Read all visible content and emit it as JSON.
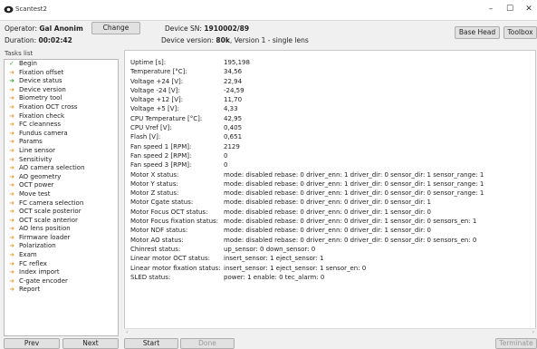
{
  "window": {
    "title": "Scantest2",
    "min_glyph": "–",
    "max_glyph": "☐",
    "close_glyph": "✕"
  },
  "header": {
    "operator_label": "Operator:",
    "operator_name": "Gal Anonim",
    "change_button": "Change",
    "duration_label": "Duration:",
    "duration_value": "00:02:42",
    "device_sn_label": "Device SN:",
    "device_sn_value": "1910002/89",
    "device_version_label": "Device version:",
    "device_version_value": "80k",
    "device_version_suffix": ", Version 1 - single lens",
    "base_head_button": "Base Head",
    "toolbox_button": "Toolbox"
  },
  "tasks": {
    "label": "Tasks list",
    "items": [
      {
        "label": "Begin",
        "icon": "check"
      },
      {
        "label": "Fixation offset",
        "icon": "arrow"
      },
      {
        "label": "Device status",
        "icon": "arrow-green"
      },
      {
        "label": "Device version",
        "icon": "arrow"
      },
      {
        "label": "Biometry tool",
        "icon": "arrow"
      },
      {
        "label": "Fixation OCT cross",
        "icon": "arrow"
      },
      {
        "label": "Fixation check",
        "icon": "arrow"
      },
      {
        "label": "FC cleanness",
        "icon": "arrow"
      },
      {
        "label": "Fundus camera",
        "icon": "arrow"
      },
      {
        "label": "Params",
        "icon": "arrow"
      },
      {
        "label": "Line sensor",
        "icon": "arrow"
      },
      {
        "label": "Sensitivity",
        "icon": "arrow"
      },
      {
        "label": "AO camera selection",
        "icon": "arrow"
      },
      {
        "label": "AO geometry",
        "icon": "arrow"
      },
      {
        "label": "OCT power",
        "icon": "arrow"
      },
      {
        "label": "Move test",
        "icon": "arrow"
      },
      {
        "label": "FC camera selection",
        "icon": "arrow"
      },
      {
        "label": "OCT scale posterior",
        "icon": "arrow"
      },
      {
        "label": "OCT scale anterior",
        "icon": "arrow"
      },
      {
        "label": "AO lens position",
        "icon": "arrow"
      },
      {
        "label": "Firmware loader",
        "icon": "arrow"
      },
      {
        "label": "Polarization",
        "icon": "arrow"
      },
      {
        "label": "Exam",
        "icon": "arrow"
      },
      {
        "label": "FC reflex",
        "icon": "arrow"
      },
      {
        "label": "Index import",
        "icon": "arrow"
      },
      {
        "label": "C-gate encoder",
        "icon": "arrow"
      },
      {
        "label": "Report",
        "icon": "arrow"
      }
    ]
  },
  "status": {
    "rows": [
      {
        "key": "Uptime [s]:",
        "value": "195,198"
      },
      {
        "key": "Temperature [°C]:",
        "value": "34,56"
      },
      {
        "key": "Voltage +24 [V]:",
        "value": "22,94"
      },
      {
        "key": "Voltage -24 [V]:",
        "value": "-24,59"
      },
      {
        "key": "Voltage +12 [V]:",
        "value": "11,70"
      },
      {
        "key": "Voltage +5 [V]:",
        "value": "4,33"
      },
      {
        "key": "CPU Temperature [°C]:",
        "value": "42,95"
      },
      {
        "key": "CPU Vref [V]:",
        "value": "0,405"
      },
      {
        "key": "Flash [V]:",
        "value": "0,651"
      },
      {
        "key": "Fan speed 1 [RPM]:",
        "value": "2129"
      },
      {
        "key": "Fan speed 2 [RPM]:",
        "value": "0"
      },
      {
        "key": "Fan speed 3 [RPM]:",
        "value": "0"
      },
      {
        "key": "Motor X status:",
        "value": "mode: disabled  rebase: 0  driver_enn: 1  driver_dir: 0  sensor_dir: 1  sensor_range: 1"
      },
      {
        "key": "Motor Y status:",
        "value": "mode: disabled  rebase: 0  driver_enn: 1  driver_dir: 0  sensor_dir: 1  sensor_range: 1"
      },
      {
        "key": "Motor Z status:",
        "value": "mode: disabled  rebase: 0  driver_enn: 1  driver_dir: 0  sensor_dir: 0  sensor_range: 1"
      },
      {
        "key": "Motor Cgate status:",
        "value": "mode: disabled  rebase: 0  driver_enn: 0  driver_dir: 0  sensor_dir: 1"
      },
      {
        "key": "Motor Focus OCT status:",
        "value": "mode: disabled  rebase: 0  driver_enn: 0  driver_dir: 1  sensor_dir: 0"
      },
      {
        "key": "Motor Focus fixation status:",
        "value": "mode: disabled  rebase: 0  driver_enn: 0  driver_dir: 1  sensor_dir: 0  sensors_en: 1"
      },
      {
        "key": "Motor NDF status:",
        "value": "mode: disabled  rebase: 0  driver_enn: 0  driver_dir: 1  sensor_dir: 0"
      },
      {
        "key": "Motor AO status:",
        "value": "mode: disabled  rebase: 0  driver_enn: 0  driver_dir: 0  sensor_dir: 0  sensors_en: 0"
      },
      {
        "key": "Chinrest status:",
        "value": "up_sensor: 0  down_sensor: 0"
      },
      {
        "key": "Linear motor OCT status:",
        "value": "insert_sensor: 1  eject_sensor: 1"
      },
      {
        "key": "Linear motor fixation status:",
        "value": "insert_sensor: 1  eject_sensor: 1  sensor_en: 0"
      },
      {
        "key": "SLED status:",
        "value": "power: 1  enable: 0  tec_alarm: 0"
      }
    ]
  },
  "footer": {
    "prev_button": "Prev",
    "next_button": "Next",
    "start_button": "Start",
    "done_button": "Done",
    "terminate_button": "Terminate"
  },
  "colors": {
    "accent_arrow": "#e8a040",
    "check_green": "#3ca83c"
  }
}
